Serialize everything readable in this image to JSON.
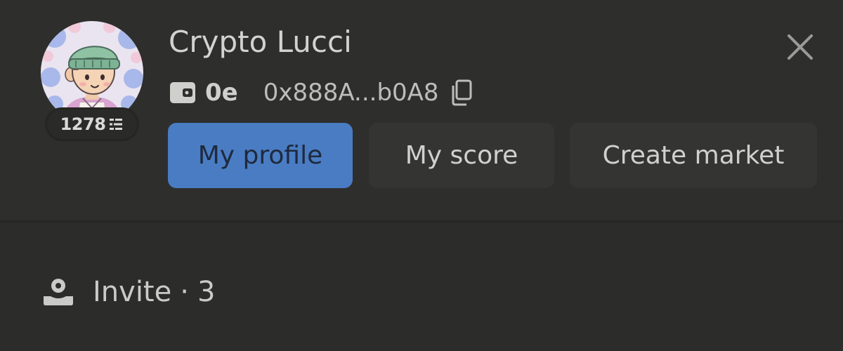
{
  "user": {
    "name": "Crypto Lucci",
    "points": "1278",
    "wallet_balance": "0e",
    "wallet_address": "0x888A...b0A8"
  },
  "actions": {
    "my_profile": "My profile",
    "my_score": "My score",
    "create_market": "Create market"
  },
  "invite": {
    "label": "Invite",
    "separator": "·",
    "count": "3"
  },
  "icons": {
    "avatar": "avatar-illustration",
    "points": "points-stack-icon",
    "wallet": "wallet-icon",
    "copy": "copy-icon",
    "close": "close-icon",
    "invite": "user-stack-icon"
  },
  "colors": {
    "background": "#2c2c2a",
    "primary_button": "#4a7cc4",
    "secondary_button": "#343432",
    "text": "#d2d2cf"
  }
}
